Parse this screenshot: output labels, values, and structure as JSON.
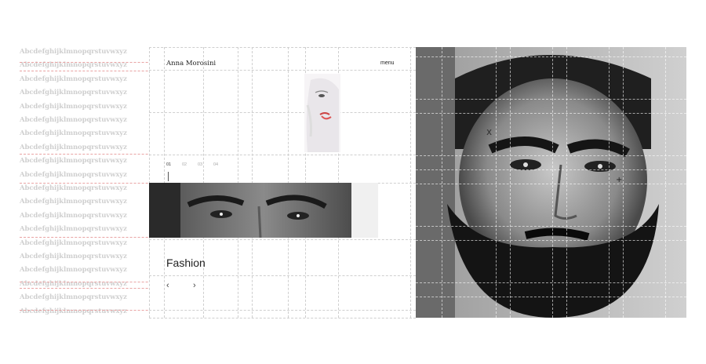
{
  "specimen": {
    "text": "Abcdefghijklmnopqrstuvwxyz",
    "lines": 20
  },
  "site": {
    "brand": "Anna Morosini",
    "menu_label": "menu",
    "slides": [
      "01",
      "02",
      "03",
      "04"
    ],
    "active_slide": "01",
    "category": "Fashion",
    "prev_label": "‹",
    "next_label": "›"
  },
  "colors": {
    "baseline": "#e9a3a3",
    "grid": "#cfcfcf",
    "specimen_text": "#cfcfcf"
  },
  "icons": {
    "prev": "chevron-left-icon",
    "next": "chevron-right-icon"
  }
}
